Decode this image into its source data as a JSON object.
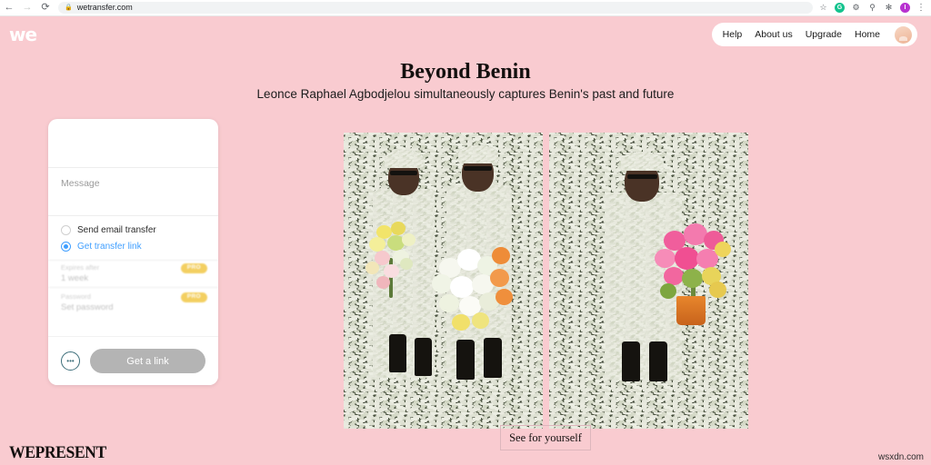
{
  "browser": {
    "back_icon": "back-arrow-icon",
    "forward_icon": "forward-arrow-icon",
    "reload_icon": "reload-icon",
    "lock_icon": "lock-icon",
    "url": "wetransfer.com",
    "star_icon": "bookmark-star-icon",
    "extensions": [
      {
        "name": "extension-green-icon",
        "glyph": "G",
        "color": "#14c38e"
      },
      {
        "name": "extension-gear-icon",
        "glyph": "⚙",
        "color": "#8a8d91"
      },
      {
        "name": "extension-search-icon",
        "glyph": "⌕",
        "color": "#8a8d91"
      },
      {
        "name": "extension-puzzle-icon",
        "glyph": "✻",
        "color": "#3c3c3c"
      },
      {
        "name": "profile-avatar-icon",
        "glyph": "I",
        "color": "#b832d0"
      }
    ],
    "menu_icon": "vertical-dots-menu-icon"
  },
  "site_header": {
    "logo": "we",
    "nav": [
      {
        "label": "Help"
      },
      {
        "label": "About us"
      },
      {
        "label": "Upgrade"
      },
      {
        "label": "Home"
      }
    ],
    "avatar_icon": "user-avatar"
  },
  "editorial": {
    "title": "Beyond Benin",
    "subtitle": "Leonce Raphael Agbodjelou simultaneously captures Benin's past and future",
    "cta_label": "See for yourself",
    "footer_logo": "WEPRESENT"
  },
  "transfer_panel": {
    "message_placeholder": "Message",
    "options": [
      {
        "label": "Send email transfer",
        "selected": false
      },
      {
        "label": "Get transfer link",
        "selected": true
      }
    ],
    "pro_rows": [
      {
        "label": "Expires after",
        "value": "1 week",
        "badge": "PRO",
        "caret": "⌄"
      },
      {
        "label": "Password",
        "value": "Set password",
        "badge": "PRO",
        "caret": ""
      }
    ],
    "more_options_icon": "ellipsis-icon",
    "more_options_glyph": "•••",
    "submit_label": "Get a link",
    "accent_color": "#409fff",
    "pro_badge_color": "#f2c94c",
    "submit_color": "#b4b4b4"
  },
  "artwork": {
    "left_photo_alt": "Two figures in camouflage uniforms holding flower bouquets against camouflage backdrop",
    "right_photo_alt": "Single figure in camouflage uniform holding pink flower bouquet against camouflage backdrop"
  },
  "watermark": "wsxdn.com",
  "theme": {
    "page_background": "#f9cbd0",
    "text_color": "#14100f"
  }
}
